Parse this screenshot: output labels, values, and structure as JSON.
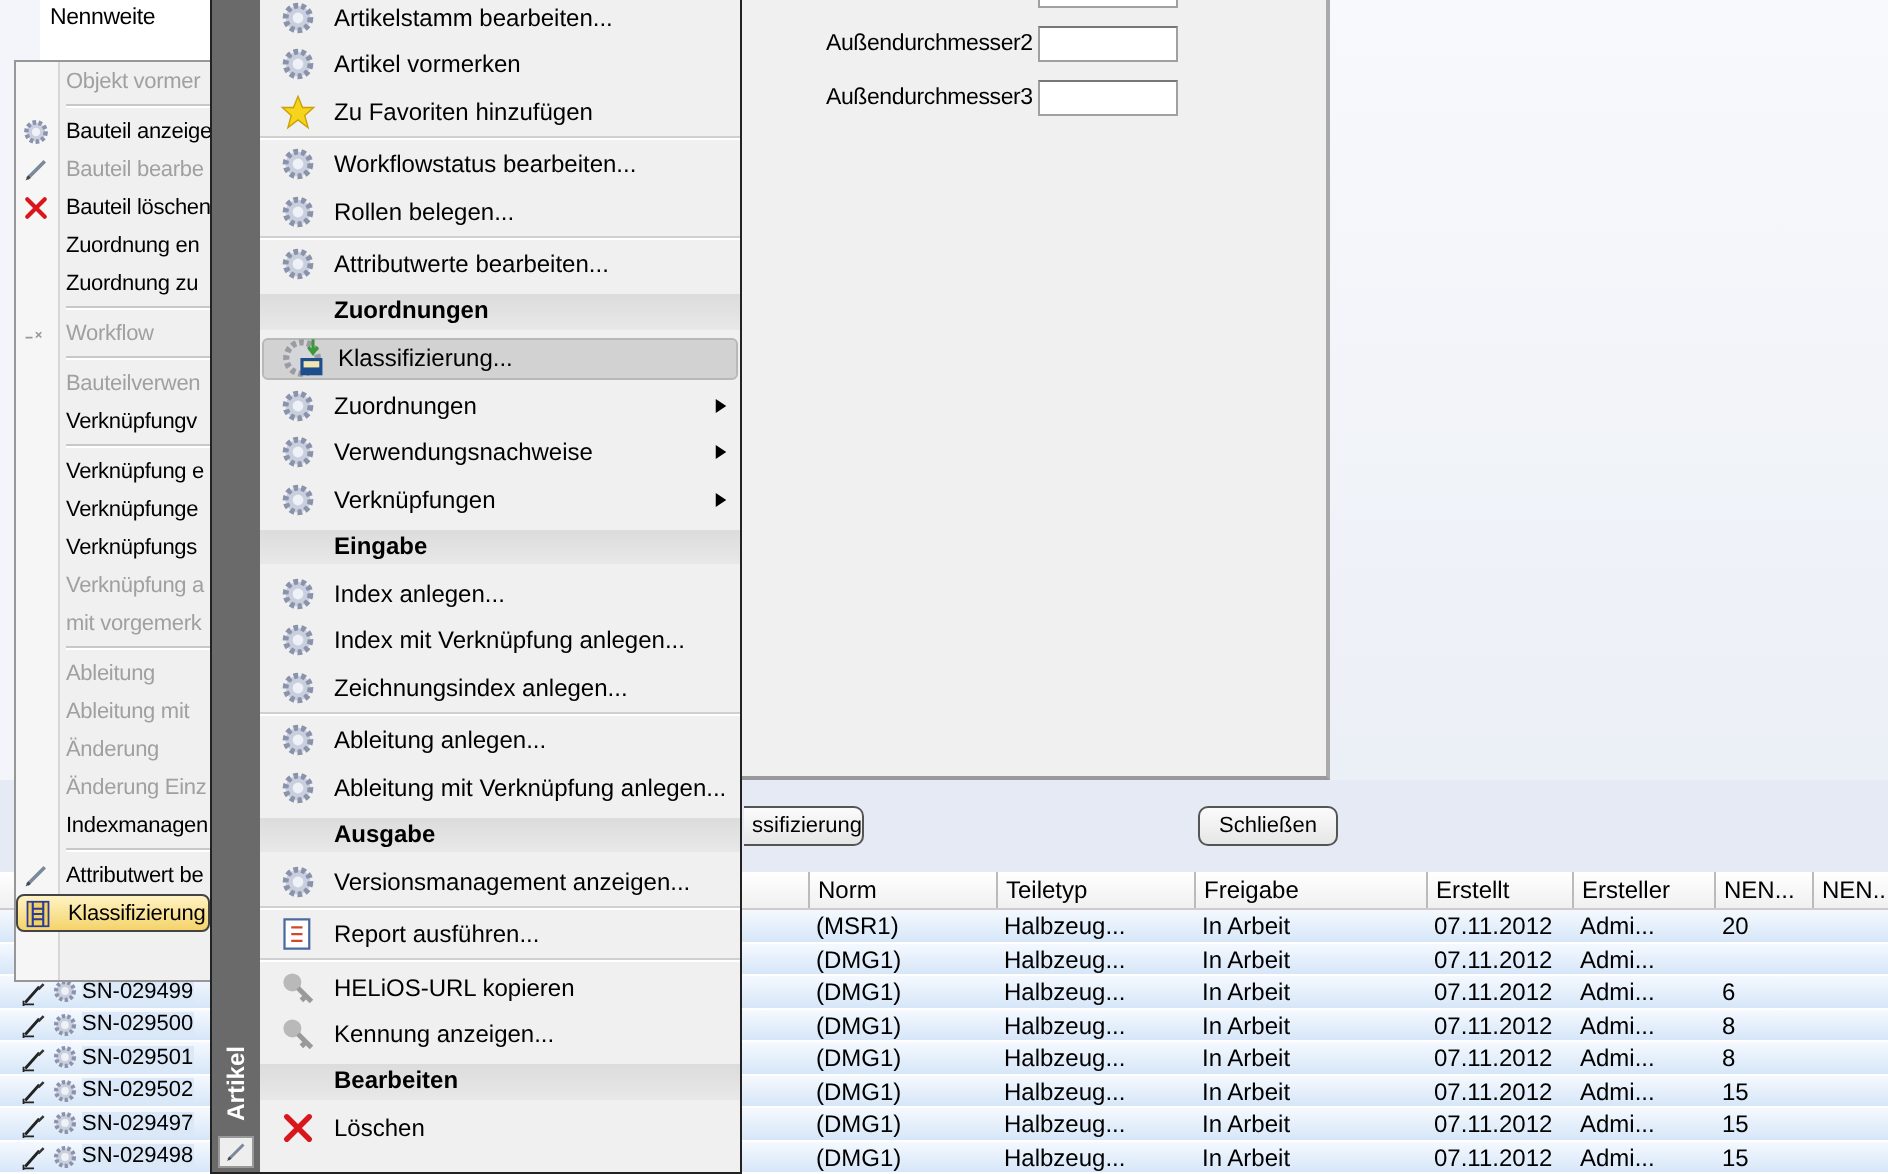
{
  "background": {
    "label": "Nennweite"
  },
  "dialog": {
    "fields": [
      {
        "label": "Außendurchmesser2"
      },
      {
        "label": "Außendurchmesser3"
      }
    ],
    "buttons": [
      "ssifizierung",
      "Schließen"
    ]
  },
  "table": {
    "columns": [
      "Norm",
      "Teiletyp",
      "Freigabe",
      "Erstellt",
      "Ersteller",
      "NEN...",
      "NEN..."
    ],
    "rows": [
      {
        "cells": [
          "(MSR1)",
          "Halbzeug...",
          "In Arbeit",
          "07.11.2012",
          "Admi...",
          "20"
        ]
      },
      {
        "cells": [
          "(DMG1)",
          "Halbzeug...",
          "In Arbeit",
          "07.11.2012",
          "Admi..."
        ]
      },
      {
        "item": "SN-029499",
        "cells": [
          "(DMG1)",
          "Halbzeug...",
          "In Arbeit",
          "07.11.2012",
          "Admi...",
          "6"
        ]
      },
      {
        "item": "SN-029500",
        "cells": [
          "(DMG1)",
          "Halbzeug...",
          "In Arbeit",
          "07.11.2012",
          "Admi...",
          "8"
        ]
      },
      {
        "item": "SN-029501",
        "cells": [
          "(DMG1)",
          "Halbzeug...",
          "In Arbeit",
          "07.11.2012",
          "Admi...",
          "8"
        ]
      },
      {
        "item": "SN-029502",
        "cells": [
          "(DMG1)",
          "Halbzeug...",
          "In Arbeit",
          "07.11.2012",
          "Admi...",
          "15"
        ]
      },
      {
        "item": "SN-029497",
        "cells": [
          "(DMG1)",
          "Halbzeug...",
          "In Arbeit",
          "07.11.2012",
          "Admi...",
          "15"
        ]
      },
      {
        "item": "SN-029498",
        "cells": [
          "(DMG1)",
          "Halbzeug...",
          "In Arbeit",
          "07.11.2012",
          "Admi...",
          "15"
        ]
      }
    ]
  },
  "context_menu": {
    "items": [
      {
        "kind": "item",
        "label": "Objekt vormer",
        "disabled": true,
        "selected": false
      },
      {
        "kind": "separator"
      },
      {
        "kind": "item",
        "label": "Bauteil anzeige",
        "disabled": false,
        "selected": false
      },
      {
        "kind": "item",
        "label": "Bauteil bearbe",
        "disabled": true,
        "selected": false
      },
      {
        "kind": "item",
        "label": "Bauteil löschen",
        "disabled": false,
        "selected": false
      },
      {
        "kind": "item",
        "label": "Zuordnung en",
        "disabled": false,
        "selected": false
      },
      {
        "kind": "item",
        "label": "Zuordnung zu",
        "disabled": false,
        "selected": false
      },
      {
        "kind": "separator"
      },
      {
        "kind": "item",
        "label": "Workflow",
        "disabled": true,
        "selected": false
      },
      {
        "kind": "separator"
      },
      {
        "kind": "item",
        "label": "Bauteilverwen",
        "disabled": true,
        "selected": false
      },
      {
        "kind": "item",
        "label": "Verknüpfungv",
        "disabled": false,
        "selected": false
      },
      {
        "kind": "separator"
      },
      {
        "kind": "item",
        "label": "Verknüpfung e",
        "disabled": false,
        "selected": false
      },
      {
        "kind": "item",
        "label": "Verknüpfunge",
        "disabled": false,
        "selected": false
      },
      {
        "kind": "item",
        "label": "Verknüpfungs",
        "disabled": false,
        "selected": false
      },
      {
        "kind": "item",
        "label": "Verknüpfung a",
        "disabled": true,
        "selected": false
      },
      {
        "kind": "item",
        "label": "mit vorgemerk",
        "disabled": true,
        "selected": false
      },
      {
        "kind": "separator"
      },
      {
        "kind": "item",
        "label": "Ableitung",
        "disabled": true,
        "selected": false
      },
      {
        "kind": "item",
        "label": "Ableitung mit",
        "disabled": true,
        "selected": false
      },
      {
        "kind": "item",
        "label": "Änderung",
        "disabled": true,
        "selected": false
      },
      {
        "kind": "item",
        "label": "Änderung Einz",
        "disabled": true,
        "selected": false
      },
      {
        "kind": "item",
        "label": "Indexmanagen",
        "disabled": false,
        "selected": false
      },
      {
        "kind": "separator"
      },
      {
        "kind": "item",
        "label": "Attributwert be",
        "disabled": false,
        "selected": false
      },
      {
        "kind": "item",
        "label": "Klassifizierung",
        "disabled": false,
        "selected": true
      }
    ]
  },
  "main_menu": {
    "title": "Artikel",
    "items": [
      {
        "kind": "item",
        "label": "Artikelstamm bearbeiten...",
        "submenu": false,
        "selected": false
      },
      {
        "kind": "item",
        "label": "Artikel vormerken",
        "submenu": false,
        "selected": false
      },
      {
        "kind": "item",
        "label": "Zu Favoriten hinzufügen",
        "submenu": false,
        "selected": false
      },
      {
        "kind": "separator"
      },
      {
        "kind": "item",
        "label": "Workflowstatus bearbeiten...",
        "submenu": false,
        "selected": false
      },
      {
        "kind": "item",
        "label": "Rollen belegen...",
        "submenu": false,
        "selected": false
      },
      {
        "kind": "separator"
      },
      {
        "kind": "item",
        "label": "Attributwerte bearbeiten...",
        "submenu": false,
        "selected": false
      },
      {
        "kind": "header",
        "label": "Zuordnungen"
      },
      {
        "kind": "item",
        "label": "Klassifizierung...",
        "submenu": false,
        "selected": true
      },
      {
        "kind": "item",
        "label": "Zuordnungen",
        "submenu": true,
        "selected": false
      },
      {
        "kind": "item",
        "label": "Verwendungsnachweise",
        "submenu": true,
        "selected": false
      },
      {
        "kind": "item",
        "label": "Verknüpfungen",
        "submenu": true,
        "selected": false
      },
      {
        "kind": "header",
        "label": "Eingabe"
      },
      {
        "kind": "item",
        "label": "Index anlegen...",
        "submenu": false,
        "selected": false
      },
      {
        "kind": "item",
        "label": "Index mit Verknüpfung anlegen...",
        "submenu": false,
        "selected": false
      },
      {
        "kind": "item",
        "label": "Zeichnungsindex anlegen...",
        "submenu": false,
        "selected": false
      },
      {
        "kind": "separator"
      },
      {
        "kind": "item",
        "label": "Ableitung anlegen...",
        "submenu": false,
        "selected": false
      },
      {
        "kind": "item",
        "label": "Ableitung mit Verknüpfung anlegen...",
        "submenu": false,
        "selected": false
      },
      {
        "kind": "header",
        "label": "Ausgabe"
      },
      {
        "kind": "item",
        "label": "Versionsmanagement anzeigen...",
        "submenu": false,
        "selected": false
      },
      {
        "kind": "separator"
      },
      {
        "kind": "item",
        "label": "Report ausführen...",
        "submenu": false,
        "selected": false
      },
      {
        "kind": "separator"
      },
      {
        "kind": "item",
        "label": "HELiOS-URL kopieren",
        "submenu": false,
        "selected": false
      },
      {
        "kind": "item",
        "label": "Kennung anzeigen...",
        "submenu": false,
        "selected": false
      },
      {
        "kind": "header",
        "label": "Bearbeiten"
      },
      {
        "kind": "item",
        "label": "Löschen",
        "submenu": false,
        "selected": false
      }
    ]
  }
}
